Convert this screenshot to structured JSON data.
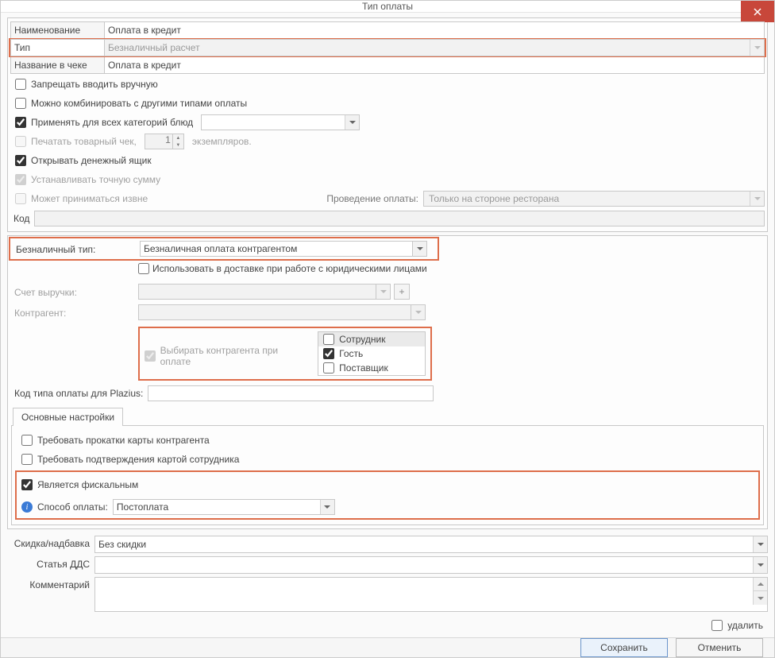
{
  "window": {
    "title": "Тип оплаты"
  },
  "fields": {
    "name_label": "Наименование",
    "name_value": "Оплата в кредит",
    "type_label": "Тип",
    "type_value": "Безналичный расчет",
    "receipt_label": "Название в чеке",
    "receipt_value": "Оплата в кредит"
  },
  "checks": {
    "manual": "Запрещать вводить вручную",
    "combine": "Можно комбинировать с другими типами оплаты",
    "all_cats": "Применять для всех категорий блюд",
    "print": "Печатать товарный чек,",
    "copies_value": "1",
    "copies_suffix": "экземпляров.",
    "drawer": "Открывать денежный ящик",
    "exact_sum": "Устанавливать точную сумму",
    "external": "Может приниматься извне",
    "ext_proc_label": "Проведение оплаты:",
    "ext_proc_value": "Только на стороне ресторана"
  },
  "code_label": "Код",
  "cashless": {
    "type_label": "Безналичный тип:",
    "type_value": "Безналичная оплата контрагентом",
    "delivery": "Использовать в доставке при работе с юридическими лицами",
    "revenue_label": "Счет выручки:",
    "counterparty_label": "Контрагент:",
    "choose_at_pay": "Выбирать контрагента при оплате",
    "list": [
      "Сотрудник",
      "Гость",
      "Поставщик"
    ],
    "plazius_label": "Код типа оплаты для Plazius:"
  },
  "tabs": {
    "main": "Основные настройки"
  },
  "settings": {
    "card_swipe": "Требовать прокатки карты контрагента",
    "emp_confirm": "Требовать подтверждения картой сотрудника",
    "fiscal": "Является фискальным",
    "method_label": "Способ оплаты:",
    "method_value": "Постоплата"
  },
  "bottom": {
    "discount_label": "Скидка/надбавка",
    "discount_value": "Без скидки",
    "dds_label": "Статья ДДС",
    "comment_label": "Комментарий",
    "delete": "удалить"
  },
  "buttons": {
    "save": "Сохранить",
    "cancel": "Отменить"
  }
}
